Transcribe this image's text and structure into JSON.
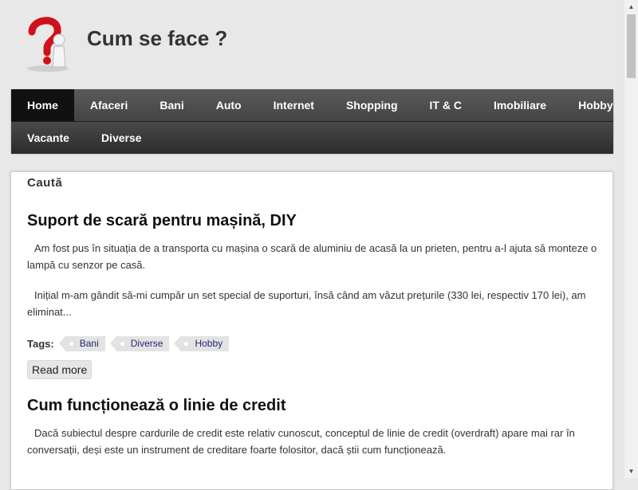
{
  "site": {
    "title": "Cum se face ?"
  },
  "nav": {
    "row1": [
      "Home",
      "Afaceri",
      "Bani",
      "Auto",
      "Internet",
      "Shopping",
      "IT & C",
      "Imobiliare",
      "Hobby"
    ],
    "row2": [
      "Vacante",
      "Diverse"
    ]
  },
  "search": {
    "label": "Caută"
  },
  "posts": [
    {
      "title": "Suport de scară pentru mașină, DIY",
      "paragraphs": [
        "Am fost pus în situația de a transporta cu mașina o scară de aluminiu de acasă la un prieten, pentru a-l ajuta să monteze o lampă cu senzor pe casă.",
        "Inițial m-am gândit să-mi cumpăr un set special de suporturi, însă când am văzut prețurile (330 lei, respectiv 170 lei), am eliminat..."
      ],
      "tags_label": "Tags:",
      "tags": [
        "Bani",
        "Diverse",
        "Hobby"
      ],
      "read_more": "Read more"
    },
    {
      "title": "Cum funcționează o linie de credit",
      "paragraphs": [
        "Dacă subiectul despre cardurile de credit este relativ cunoscut, conceptul de linie de credit (overdraft) apare mai rar în conversații, deși este un instrument de creditare foarte folositor, dacă știi cum funcționează."
      ]
    }
  ],
  "colors": {
    "page_background": "#e8e8e8",
    "nav_background": "#3a3a3a",
    "nav_active": "#111111",
    "tag_text": "#26267a",
    "logo_question_mark": "#d0101a"
  },
  "icons": {
    "logo": "thinking-person-question-mark-icon",
    "scroll_up": "triangle-up-icon",
    "scroll_down": "triangle-down-icon"
  }
}
